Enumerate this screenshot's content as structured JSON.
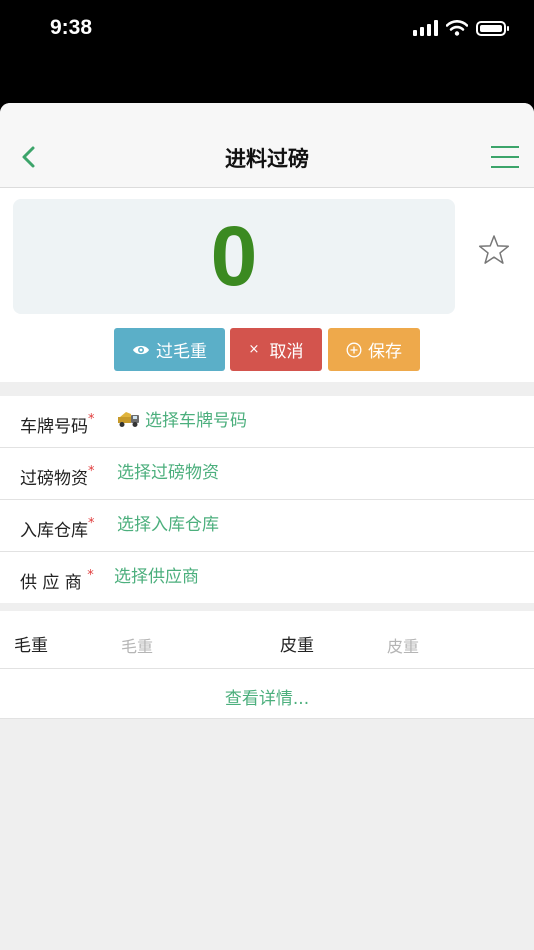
{
  "status_bar": {
    "time": "9:38"
  },
  "nav": {
    "title": "进料过磅"
  },
  "scale": {
    "weight": "0"
  },
  "actions": {
    "gross_label": "过毛重",
    "cancel_label": "取消",
    "cancel_glyph": "×",
    "save_label": "保存"
  },
  "form": {
    "plate": {
      "label": "车牌号码",
      "required": "*",
      "value": "选择车牌号码"
    },
    "material": {
      "label": "过磅物资",
      "required": "*",
      "value": "选择过磅物资"
    },
    "warehouse": {
      "label": "入库仓库",
      "required": "*",
      "value": "选择入库仓库"
    },
    "supplier": {
      "label": "供 应 商",
      "required": "*",
      "value": "选择供应商"
    }
  },
  "weights": {
    "gross_label": "毛重",
    "gross_placeholder": "毛重",
    "tare_label": "皮重",
    "tare_placeholder": "皮重",
    "details_link": "查看详情..."
  },
  "colors": {
    "accent_green": "#4caf7d",
    "weight_green": "#3b8a21",
    "gross_button": "#5bafc8",
    "cancel_button": "#d3544d",
    "save_button": "#eea94b",
    "required_red": "#e03b3b"
  }
}
